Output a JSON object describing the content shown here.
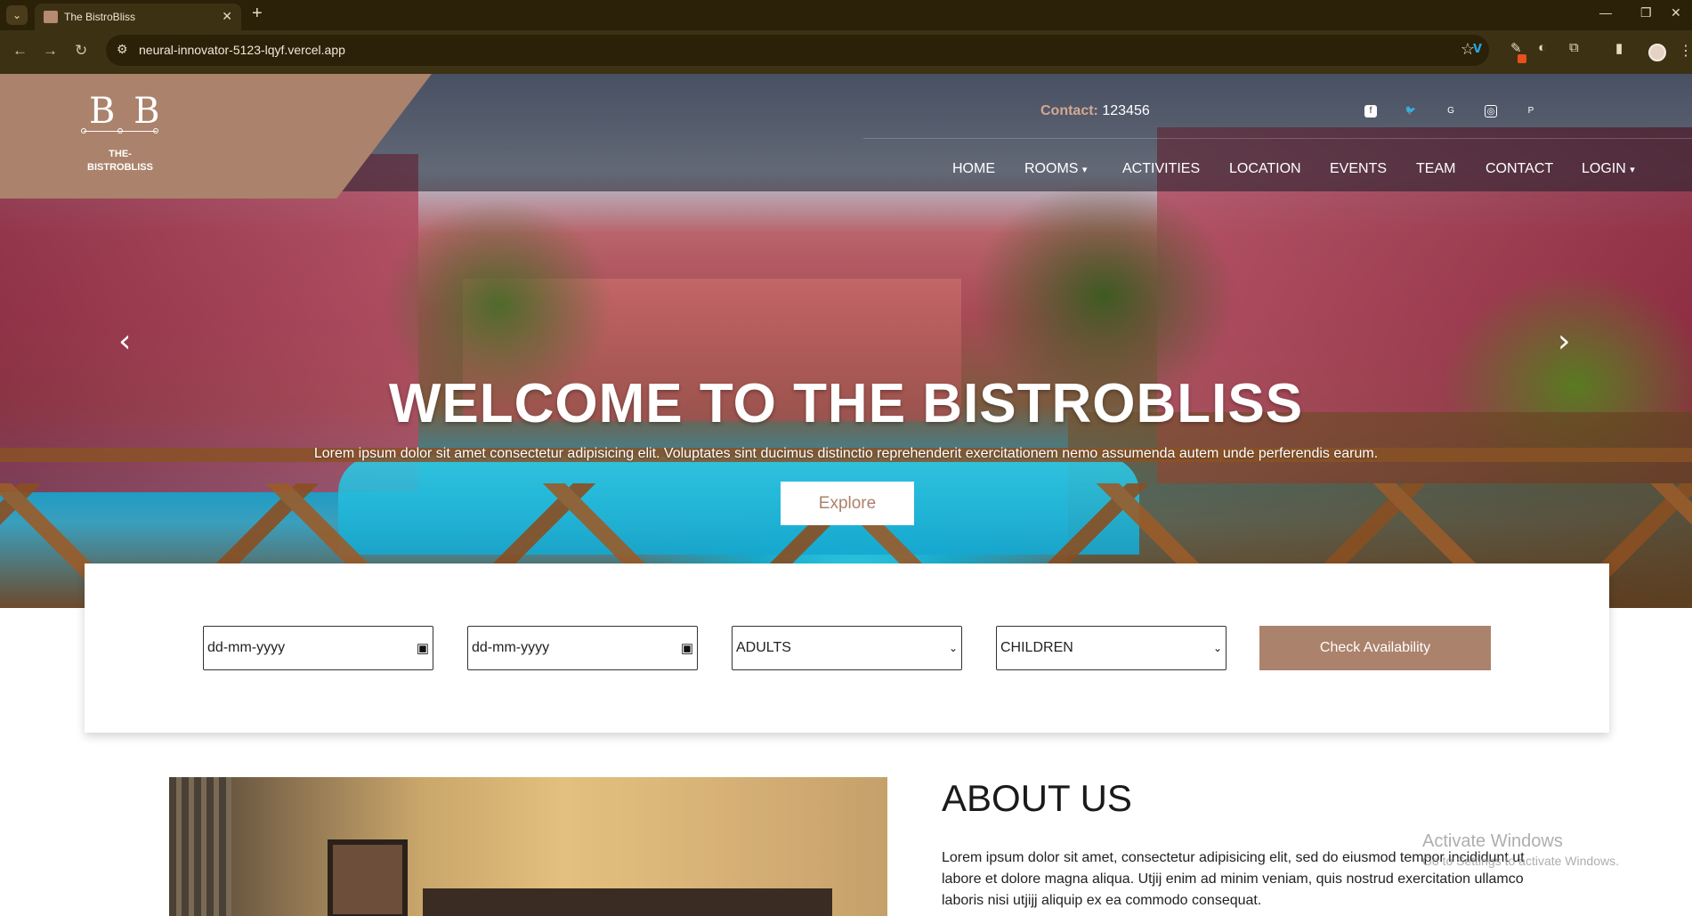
{
  "browser": {
    "tab_title": "The BistroBliss",
    "url": "neural-innovator-5123-lqyf.vercel.app",
    "new_tab": "+",
    "close": "✕"
  },
  "logo": {
    "mark": "B B",
    "name_line1": "THE-",
    "name_line2": "BISTROBLISS"
  },
  "contact": {
    "label": "Contact:",
    "value": "123456"
  },
  "socials": [
    "facebook-icon",
    "twitter-icon",
    "google-plus-icon",
    "instagram-icon",
    "pinterest-icon"
  ],
  "nav": {
    "home": "HOME",
    "rooms": "ROOMS",
    "activities": "ACTIVITIES",
    "location": "LOCATION",
    "events": "EVENTS",
    "team": "TEAM",
    "contact": "CONTACT",
    "login": "LOGIN"
  },
  "hero": {
    "title": "WELCOME TO THE BISTROBLISS",
    "subtitle": "Lorem ipsum dolor sit amet consectetur adipisicing elit. Voluptates sint ducimus distinctio reprehenderit exercitationem nemo assumenda autem unde perferendis earum.",
    "cta": "Explore"
  },
  "booking": {
    "checkin_placeholder": "dd-mm-yyyy",
    "checkout_placeholder": "dd-mm-yyyy",
    "adults": "ADULTS",
    "children": "CHILDREN",
    "button": "Check Availability"
  },
  "about": {
    "title": "ABOUT US",
    "text": "Lorem ipsum dolor sit amet, consectetur adipisicing elit, sed do eiusmod tempor incididunt ut labore et dolore magna aliqua. Utjij enim ad minim veniam, quis nostrud exercitation ullamco laboris nisi utjijj aliquip ex ea commodo consequat."
  },
  "watermark": {
    "line1": "Activate Windows",
    "line2": "Go to Settings to activate Windows."
  },
  "colors": {
    "accent": "#ab826b",
    "chrome_dark": "#2b2108",
    "chrome_toolbar": "#3d3114"
  }
}
